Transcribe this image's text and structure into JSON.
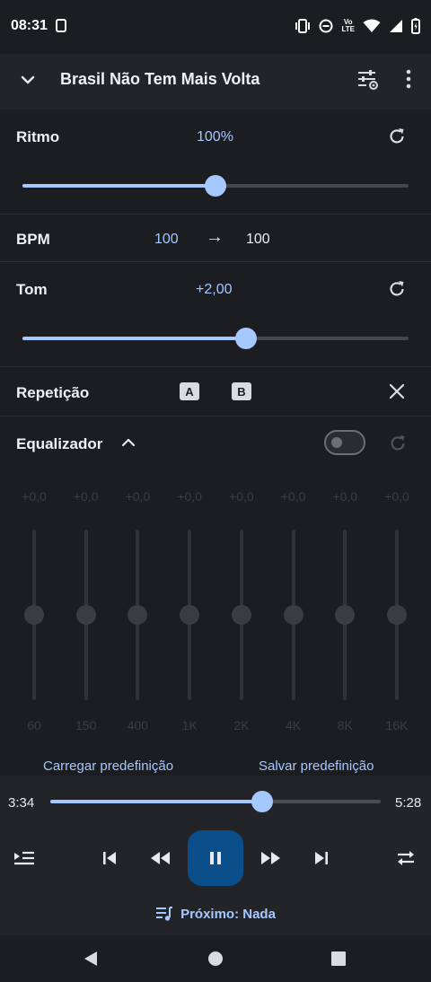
{
  "status_bar": {
    "time": "08:31",
    "network_label_top": "Vo",
    "network_label_bottom": "LTE",
    "icons": [
      "sim-icon",
      "vibrate-icon",
      "dnd-icon",
      "wifi-icon",
      "signal-icon",
      "battery-charging-icon"
    ]
  },
  "app_bar": {
    "title": "Brasil Não Tem Mais Volta",
    "back_icon": "chevron-down-icon",
    "tune_icon": "equalizer-settings-icon",
    "more_icon": "more-vert-icon"
  },
  "tempo": {
    "label": "Ritmo",
    "value_text": "100%",
    "slider_fraction": 0.5,
    "reset_icon": "reset-icon"
  },
  "bpm": {
    "label": "BPM",
    "from": "100",
    "arrow": "→",
    "to": "100"
  },
  "pitch": {
    "label": "Tom",
    "value_text": "+2,00",
    "slider_fraction": 0.58,
    "reset_icon": "reset-icon"
  },
  "repeat": {
    "label": "Repetição",
    "a_label": "A",
    "b_label": "B",
    "close_icon": "close-icon"
  },
  "equalizer": {
    "label": "Equalizador",
    "enabled": false,
    "expand_icon": "chevron-up-icon",
    "reset_icon": "reset-icon",
    "bands": [
      {
        "gain": "+0,0",
        "freq": "60",
        "level": 0.5
      },
      {
        "gain": "+0,0",
        "freq": "150",
        "level": 0.5
      },
      {
        "gain": "+0,0",
        "freq": "400",
        "level": 0.5
      },
      {
        "gain": "+0,0",
        "freq": "1K",
        "level": 0.5
      },
      {
        "gain": "+0,0",
        "freq": "2K",
        "level": 0.5
      },
      {
        "gain": "+0,0",
        "freq": "4K",
        "level": 0.5
      },
      {
        "gain": "+0,0",
        "freq": "8K",
        "level": 0.5
      },
      {
        "gain": "+0,0",
        "freq": "16K",
        "level": 0.5
      }
    ],
    "load_preset": "Carregar predefinição",
    "save_preset": "Salvar predefinição"
  },
  "player": {
    "elapsed": "3:34",
    "duration": "5:28",
    "progress_fraction": 0.64,
    "next_up": "Próximo: Nada",
    "controls": [
      "queue-add-icon",
      "skip-previous-icon",
      "rewind-icon",
      "pause-icon",
      "fast-forward-icon",
      "skip-next-icon",
      "repeat-icon"
    ]
  },
  "nav_bar": {
    "icons": [
      "back-triangle-icon",
      "home-circle-icon",
      "recents-square-icon"
    ]
  },
  "colors": {
    "accent": "#a5c8ff",
    "play_button": "#0a4f8a",
    "background": "#1c1d21",
    "panel": "#232428"
  }
}
